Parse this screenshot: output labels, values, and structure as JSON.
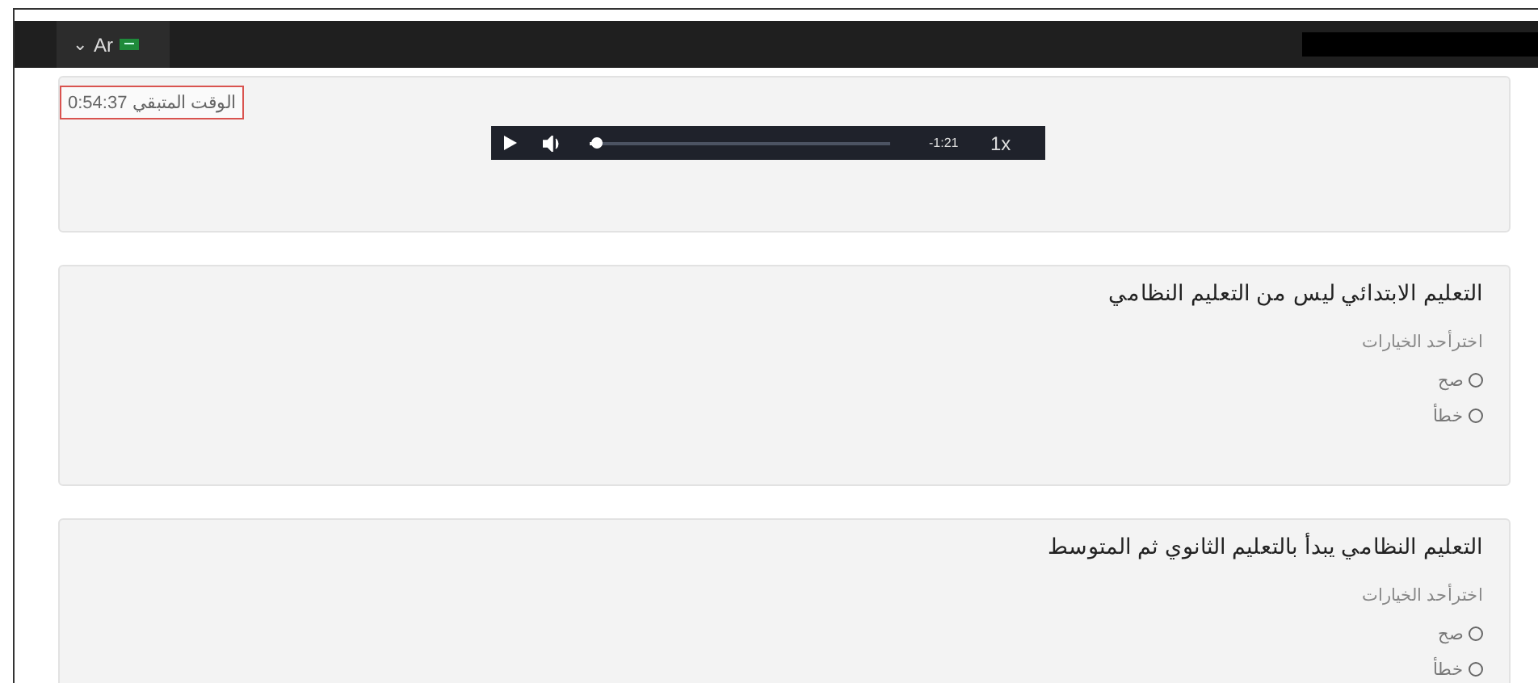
{
  "topbar": {
    "language": {
      "caret": "⌄",
      "label": "Ar"
    }
  },
  "timer": {
    "label": "الوقت المتبقي",
    "value": "0:54:37"
  },
  "audio_player": {
    "playing": false,
    "level": 0.02,
    "remaining": "-1:21",
    "speed": "1x"
  },
  "questions": [
    {
      "text": "التعليم الابتدائي ليس من التعليم النظامي",
      "instruction": "اخترأحد الخيارات",
      "options": [
        {
          "label": "صح",
          "selected": false
        },
        {
          "label": "خطأ",
          "selected": false
        }
      ]
    },
    {
      "text": "التعليم النظامي يبدأ بالتعليم الثانوي ثم المتوسط",
      "instruction": "اخترأحد الخيارات",
      "options": [
        {
          "label": "صح",
          "selected": false
        },
        {
          "label": "خطأ",
          "selected": false
        }
      ]
    }
  ]
}
